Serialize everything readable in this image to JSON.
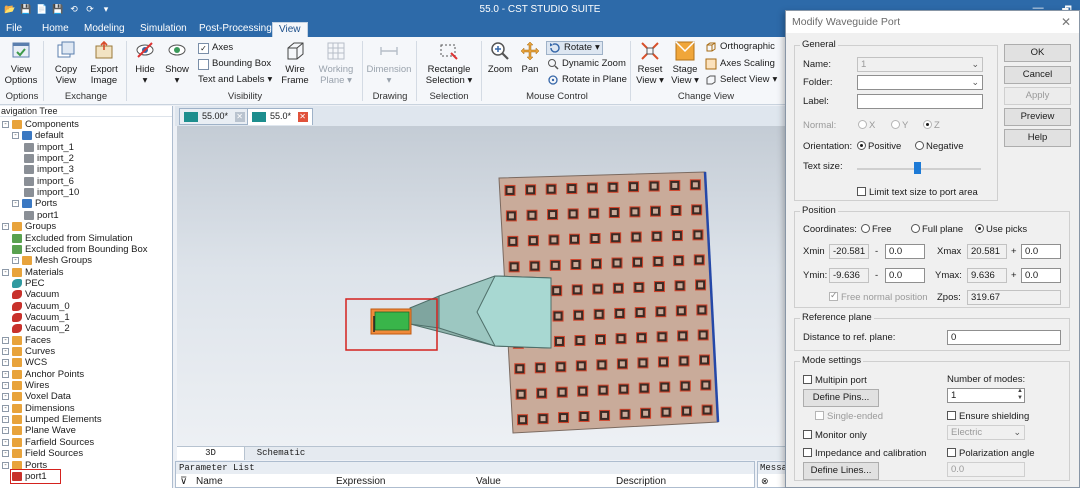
{
  "window": {
    "title": "55.0 - CST STUDIO SUITE",
    "minimize": "—",
    "maximize": "🗗"
  },
  "quick_access": [
    "📂",
    "💾",
    "📄",
    "💾",
    "⟲",
    "⟳",
    "▾"
  ],
  "menu": {
    "tabs": [
      "File",
      "Home",
      "Modeling",
      "Simulation",
      "Post-Processing",
      "View"
    ],
    "active": "View"
  },
  "ribbon": {
    "view_options": "View\nOptions",
    "options_label": "Options",
    "copy_view": "Copy\nView",
    "export_image": "Export\nImage",
    "exchange_label": "Exchange",
    "hide": "Hide",
    "show": "Show",
    "axes": "Axes",
    "bounding_box": "Bounding Box",
    "text_labels": "Text and Labels",
    "wire_frame": "Wire\nFrame",
    "working_plane": "Working\nPlane",
    "visibility_label": "Visibility",
    "dimension": "Dimension",
    "drawing_label": "Drawing",
    "rectangle_selection": "Rectangle\nSelection",
    "selection_label": "Selection",
    "zoom": "Zoom",
    "pan": "Pan",
    "rotate": "Rotate",
    "dynamic_zoom": "Dynamic Zoom",
    "rotate_in_plane": "Rotate in Plane",
    "mouse_control_label": "Mouse Control",
    "reset_view": "Reset\nView",
    "stage_view": "Stage\nView",
    "orthographic": "Orthographic",
    "axes_scaling": "Axes Scaling",
    "select_view": "Select View",
    "change_view_label": "Change View"
  },
  "nav_tree": {
    "title": "avigation Tree",
    "items": [
      {
        "label": "Components",
        "level": 0,
        "icon": "folder",
        "color": "#e8a33b"
      },
      {
        "label": "default",
        "level": 1,
        "icon": "component",
        "color": "#3a78c2"
      },
      {
        "label": "import_1",
        "level": 2,
        "icon": "solid",
        "color": "#8a8f96"
      },
      {
        "label": "import_2",
        "level": 2,
        "icon": "solid",
        "color": "#8a8f96"
      },
      {
        "label": "import_3",
        "level": 2,
        "icon": "solid",
        "color": "#8a8f96"
      },
      {
        "label": "import_6",
        "level": 2,
        "icon": "solid",
        "color": "#8a8f96"
      },
      {
        "label": "import_10",
        "level": 2,
        "icon": "solid",
        "color": "#8a8f96"
      },
      {
        "label": "Ports",
        "level": 1,
        "icon": "component",
        "color": "#3a78c2"
      },
      {
        "label": "port1",
        "level": 2,
        "icon": "solid",
        "color": "#8a8f96"
      },
      {
        "label": "Groups",
        "level": 0,
        "icon": "folder",
        "color": "#e8a33b"
      },
      {
        "label": "Excluded from Simulation",
        "level": 1,
        "icon": "group",
        "color": "#59a14f"
      },
      {
        "label": "Excluded from Bounding Box",
        "level": 1,
        "icon": "group",
        "color": "#59a14f"
      },
      {
        "label": "Mesh Groups",
        "level": 1,
        "icon": "folder",
        "color": "#e8a33b"
      },
      {
        "label": "Materials",
        "level": 0,
        "icon": "folder",
        "color": "#e8a33b"
      },
      {
        "label": "PEC",
        "level": 1,
        "icon": "material",
        "color": "#2f9aa0"
      },
      {
        "label": "Vacuum",
        "level": 1,
        "icon": "material",
        "color": "#c8312b"
      },
      {
        "label": "Vacuum_0",
        "level": 1,
        "icon": "material",
        "color": "#c8312b"
      },
      {
        "label": "Vacuum_1",
        "level": 1,
        "icon": "material",
        "color": "#c8312b"
      },
      {
        "label": "Vacuum_2",
        "level": 1,
        "icon": "material",
        "color": "#c8312b"
      },
      {
        "label": "Faces",
        "level": 0,
        "icon": "folder",
        "color": "#e8a33b"
      },
      {
        "label": "Curves",
        "level": 0,
        "icon": "folder",
        "color": "#e8a33b"
      },
      {
        "label": "WCS",
        "level": 0,
        "icon": "folder",
        "color": "#e8a33b"
      },
      {
        "label": "Anchor Points",
        "level": 0,
        "icon": "folder",
        "color": "#e8a33b"
      },
      {
        "label": "Wires",
        "level": 0,
        "icon": "folder",
        "color": "#e8a33b"
      },
      {
        "label": "Voxel Data",
        "level": 0,
        "icon": "folder",
        "color": "#e8a33b"
      },
      {
        "label": "Dimensions",
        "level": 0,
        "icon": "folder",
        "color": "#e8a33b"
      },
      {
        "label": "Lumped Elements",
        "level": 0,
        "icon": "folder",
        "color": "#e8a33b"
      },
      {
        "label": "Plane Wave",
        "level": 0,
        "icon": "folder",
        "color": "#e8a33b"
      },
      {
        "label": "Farfield Sources",
        "level": 0,
        "icon": "folder",
        "color": "#e8a33b"
      },
      {
        "label": "Field Sources",
        "level": 0,
        "icon": "folder",
        "color": "#e8a33b"
      },
      {
        "label": "Ports",
        "level": 0,
        "icon": "folder",
        "color": "#e8a33b"
      },
      {
        "label": "port1",
        "level": 1,
        "icon": "port",
        "color": "#c8312b"
      }
    ]
  },
  "doc_tabs": [
    {
      "label": "55.00*",
      "active": false
    },
    {
      "label": "55.0*",
      "active": true
    }
  ],
  "view_tabs": [
    {
      "label": "3D",
      "active": true
    },
    {
      "label": "Schematic",
      "active": false
    }
  ],
  "param_list": {
    "title": "Parameter List",
    "columns": [
      "Name",
      "Expression",
      "Value",
      "Description"
    ]
  },
  "messages": {
    "title": "Messag"
  },
  "dialog": {
    "title": "Modify Waveguide Port",
    "close": "✕",
    "buttons": {
      "ok": "OK",
      "cancel": "Cancel",
      "apply": "Apply",
      "preview": "Preview",
      "help": "Help"
    },
    "general": {
      "title": "General",
      "name_label": "Name:",
      "name_value": "1",
      "folder_label": "Folder:",
      "folder_value": "",
      "label_label": "Label:",
      "label_value": "",
      "normal_label": "Normal:",
      "normal_x": "X",
      "normal_y": "Y",
      "normal_z": "Z",
      "orientation_label": "Orientation:",
      "positive": "Positive",
      "negative": "Negative",
      "text_size_label": "Text size:",
      "limit_text": "Limit text size to port area"
    },
    "position": {
      "title": "Position",
      "coordinates_label": "Coordinates:",
      "free": "Free",
      "full_plane": "Full plane",
      "use_picks": "Use picks",
      "xmin_label": "Xmin",
      "xmin": "-20.581",
      "xmin_offset": "0.0",
      "xmax_label": "Xmax",
      "xmax": "20.581",
      "xmax_offset": "0.0",
      "ymin_label": "Ymin:",
      "ymin": "-9.636",
      "ymin_offset": "0.0",
      "ymax_label": "Ymax:",
      "ymax": "9.636",
      "ymax_offset": "0.0",
      "minus": "-",
      "plus": "+",
      "free_normal": "Free normal position",
      "zpos_label": "Zpos:",
      "zpos": "319.67"
    },
    "reference_plane": {
      "title": "Reference plane",
      "distance_label": "Distance to ref. plane:",
      "distance_value": "0"
    },
    "mode_settings": {
      "title": "Mode settings",
      "multipin": "Multipin port",
      "define_pins": "Define Pins...",
      "single_ended": "Single-ended",
      "monitor_only": "Monitor only",
      "impedance": "Impedance and calibration",
      "define_lines": "Define Lines...",
      "num_modes_label": "Number of modes:",
      "num_modes": "1",
      "ensure_shielding": "Ensure shielding",
      "shielding_type": "Electric",
      "polarization_angle": "Polarization angle",
      "polarization_value": "0.0"
    }
  }
}
